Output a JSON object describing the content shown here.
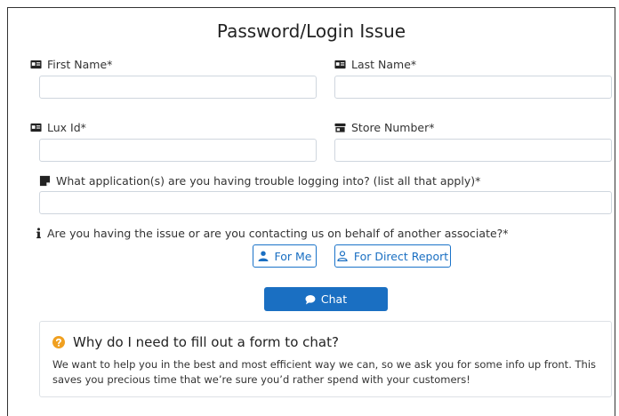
{
  "form": {
    "title": "Password/Login Issue",
    "first_name": {
      "label": "First Name*",
      "value": ""
    },
    "last_name": {
      "label": "Last Name*",
      "value": ""
    },
    "lux_id": {
      "label": "Lux Id*",
      "value": ""
    },
    "store_number": {
      "label": "Store Number*",
      "value": ""
    },
    "applications": {
      "label": "What application(s) are you having trouble logging into? (list all that apply)*",
      "value": ""
    },
    "behalf_question": "Are you having the issue or are you contacting us on behalf of another associate?*",
    "for_me_label": "For Me",
    "for_direct_report_label": "For Direct Report",
    "chat_label": "Chat"
  },
  "info": {
    "heading": "Why do I need to fill out a form to chat?",
    "body": "We want to help you in the best and most efficient way we can, so we ask you for some info up front. This saves you precious time that we’re sure you’d rather spend with your customers!"
  },
  "colors": {
    "accent": "#1a6fc2",
    "warning": "#f0a020",
    "border": "#cfd6de"
  }
}
